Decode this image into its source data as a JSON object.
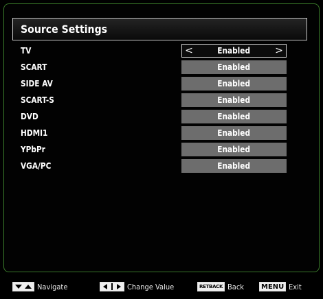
{
  "title": "Source Settings",
  "sources": [
    {
      "label": "TV",
      "value": "Enabled",
      "selected": true
    },
    {
      "label": "SCART",
      "value": "Enabled",
      "selected": false
    },
    {
      "label": "SIDE AV",
      "value": "Enabled",
      "selected": false
    },
    {
      "label": "SCART-S",
      "value": "Enabled",
      "selected": false
    },
    {
      "label": "DVD",
      "value": "Enabled",
      "selected": false
    },
    {
      "label": "HDMI1",
      "value": "Enabled",
      "selected": false
    },
    {
      "label": "YPbPr",
      "value": "Enabled",
      "selected": false
    },
    {
      "label": "VGA/PC",
      "value": "Enabled",
      "selected": false
    }
  ],
  "selector_arrows": {
    "left": "<",
    "right": ">"
  },
  "footer": {
    "navigate_label": "Navigate",
    "change_value_label": "Change Value",
    "back_key": "RETBACK",
    "back_label": "Back",
    "menu_key": "MENU",
    "exit_label": "Exit"
  },
  "colors": {
    "frame": "#3a7a2a",
    "value_box": "#6d6d6d",
    "selected_box": "#0c0c0c"
  }
}
